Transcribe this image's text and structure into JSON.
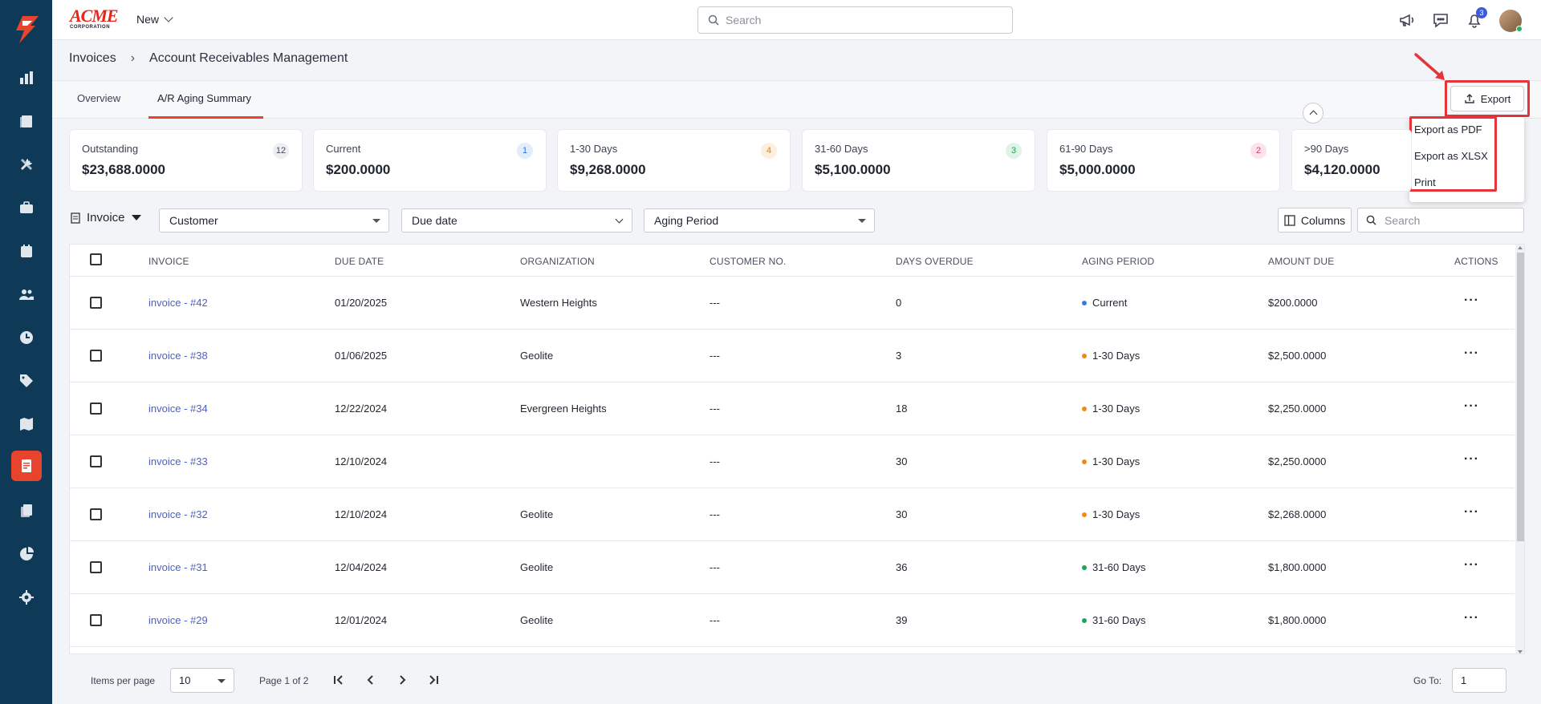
{
  "app": {
    "brand_main": "ACME",
    "brand_sub": "CORPORATION",
    "new_label": "New",
    "search_placeholder": "Search",
    "notification_count": "3"
  },
  "breadcrumb": {
    "parent": "Invoices",
    "current": "Account Receivables Management"
  },
  "tabs": [
    {
      "label": "Overview",
      "active": false
    },
    {
      "label": "A/R Aging Summary",
      "active": true
    }
  ],
  "export": {
    "label": "Export",
    "menu": [
      "Export as PDF",
      "Export as XLSX",
      "Print"
    ],
    "highlight_color": "#e5353b"
  },
  "summary_cards": [
    {
      "label": "Outstanding",
      "value": "$23,688.0000",
      "count": "12",
      "badge_bg": "#eceef2",
      "badge_fg": "#444b59"
    },
    {
      "label": "Current",
      "value": "$200.0000",
      "count": "1",
      "badge_bg": "#e3ecfb",
      "badge_fg": "#3a6fd8"
    },
    {
      "label": "1-30 Days",
      "value": "$9,268.0000",
      "count": "4",
      "badge_bg": "#fdeedd",
      "badge_fg": "#d9801f"
    },
    {
      "label": "31-60 Days",
      "value": "$5,100.0000",
      "count": "3",
      "badge_bg": "#def5e6",
      "badge_fg": "#21a157"
    },
    {
      "label": "61-90 Days",
      "value": "$5,000.0000",
      "count": "2",
      "badge_bg": "#fde1ec",
      "badge_fg": "#d63a7a"
    },
    {
      "label": ">90 Days",
      "value": "$4,120.0000",
      "count": "",
      "badge_bg": "#ffffff",
      "badge_fg": "#ffffff"
    }
  ],
  "filters": {
    "view_label": "Invoice",
    "customer": "Customer",
    "due_date": "Due date",
    "aging_period": "Aging Period",
    "columns_label": "Columns",
    "search_placeholder": "Search"
  },
  "table": {
    "columns": [
      "INVOICE",
      "DUE DATE",
      "ORGANIZATION",
      "CUSTOMER NO.",
      "DAYS OVERDUE",
      "AGING PERIOD",
      "AMOUNT DUE",
      "ACTIONS"
    ],
    "period_colors": {
      "Current": "#3a7be0",
      "1-30 Days": "#f08a16",
      "31-60 Days": "#1fa552"
    },
    "rows": [
      {
        "invoice": "invoice - #42",
        "due": "01/20/2025",
        "org": "Western Heights",
        "cust": "---",
        "days": "0",
        "period": "Current",
        "amount": "$200.0000"
      },
      {
        "invoice": "invoice - #38",
        "due": "01/06/2025",
        "org": "Geolite",
        "cust": "---",
        "days": "3",
        "period": "1-30 Days",
        "amount": "$2,500.0000"
      },
      {
        "invoice": "invoice - #34",
        "due": "12/22/2024",
        "org": "Evergreen Heights",
        "cust": "---",
        "days": "18",
        "period": "1-30 Days",
        "amount": "$2,250.0000"
      },
      {
        "invoice": "invoice - #33",
        "due": "12/10/2024",
        "org": "",
        "cust": "---",
        "days": "30",
        "period": "1-30 Days",
        "amount": "$2,250.0000"
      },
      {
        "invoice": "invoice - #32",
        "due": "12/10/2024",
        "org": "Geolite",
        "cust": "---",
        "days": "30",
        "period": "1-30 Days",
        "amount": "$2,268.0000"
      },
      {
        "invoice": "invoice - #31",
        "due": "12/04/2024",
        "org": "Geolite",
        "cust": "---",
        "days": "36",
        "period": "31-60 Days",
        "amount": "$1,800.0000"
      },
      {
        "invoice": "invoice - #29",
        "due": "12/01/2024",
        "org": "Geolite",
        "cust": "---",
        "days": "39",
        "period": "31-60 Days",
        "amount": "$1,800.0000"
      }
    ]
  },
  "pagination": {
    "items_per_page_label": "Items per page",
    "items_per_page": "10",
    "page_info": "Page 1 of 2",
    "goto_label": "Go To:",
    "goto_value": "1"
  },
  "sidebar": {
    "items": [
      "dashboard-chart-icon",
      "tasks-icon",
      "tools-icon",
      "briefcase-icon",
      "calendar-icon",
      "users-icon",
      "clock-icon",
      "tag-icon",
      "map-icon",
      "invoice-icon",
      "documents-icon",
      "pie-chart-icon",
      "settings-icon"
    ],
    "active_index": 9,
    "accent": "#e8442d"
  }
}
